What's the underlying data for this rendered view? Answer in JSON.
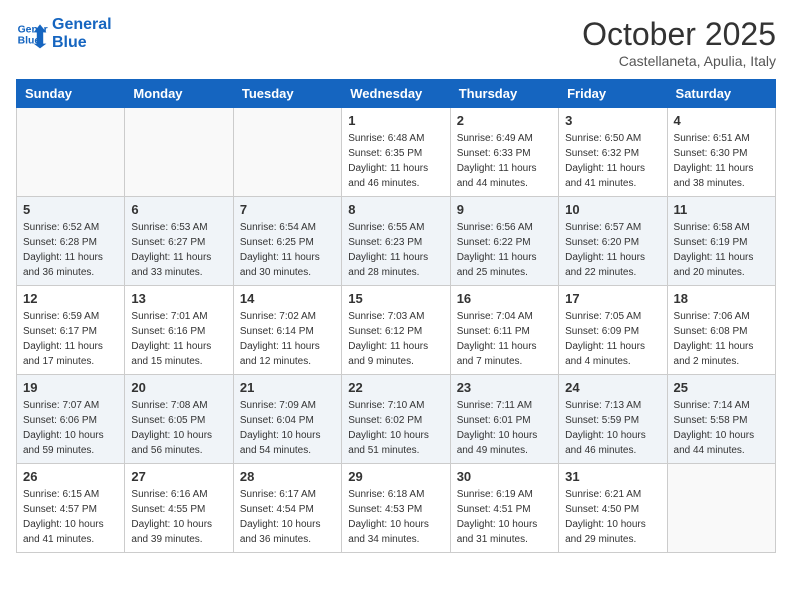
{
  "header": {
    "logo_line1": "General",
    "logo_line2": "Blue",
    "month": "October 2025",
    "location": "Castellaneta, Apulia, Italy"
  },
  "weekdays": [
    "Sunday",
    "Monday",
    "Tuesday",
    "Wednesday",
    "Thursday",
    "Friday",
    "Saturday"
  ],
  "weeks": [
    [
      {
        "day": "",
        "info": ""
      },
      {
        "day": "",
        "info": ""
      },
      {
        "day": "",
        "info": ""
      },
      {
        "day": "1",
        "info": "Sunrise: 6:48 AM\nSunset: 6:35 PM\nDaylight: 11 hours\nand 46 minutes."
      },
      {
        "day": "2",
        "info": "Sunrise: 6:49 AM\nSunset: 6:33 PM\nDaylight: 11 hours\nand 44 minutes."
      },
      {
        "day": "3",
        "info": "Sunrise: 6:50 AM\nSunset: 6:32 PM\nDaylight: 11 hours\nand 41 minutes."
      },
      {
        "day": "4",
        "info": "Sunrise: 6:51 AM\nSunset: 6:30 PM\nDaylight: 11 hours\nand 38 minutes."
      }
    ],
    [
      {
        "day": "5",
        "info": "Sunrise: 6:52 AM\nSunset: 6:28 PM\nDaylight: 11 hours\nand 36 minutes."
      },
      {
        "day": "6",
        "info": "Sunrise: 6:53 AM\nSunset: 6:27 PM\nDaylight: 11 hours\nand 33 minutes."
      },
      {
        "day": "7",
        "info": "Sunrise: 6:54 AM\nSunset: 6:25 PM\nDaylight: 11 hours\nand 30 minutes."
      },
      {
        "day": "8",
        "info": "Sunrise: 6:55 AM\nSunset: 6:23 PM\nDaylight: 11 hours\nand 28 minutes."
      },
      {
        "day": "9",
        "info": "Sunrise: 6:56 AM\nSunset: 6:22 PM\nDaylight: 11 hours\nand 25 minutes."
      },
      {
        "day": "10",
        "info": "Sunrise: 6:57 AM\nSunset: 6:20 PM\nDaylight: 11 hours\nand 22 minutes."
      },
      {
        "day": "11",
        "info": "Sunrise: 6:58 AM\nSunset: 6:19 PM\nDaylight: 11 hours\nand 20 minutes."
      }
    ],
    [
      {
        "day": "12",
        "info": "Sunrise: 6:59 AM\nSunset: 6:17 PM\nDaylight: 11 hours\nand 17 minutes."
      },
      {
        "day": "13",
        "info": "Sunrise: 7:01 AM\nSunset: 6:16 PM\nDaylight: 11 hours\nand 15 minutes."
      },
      {
        "day": "14",
        "info": "Sunrise: 7:02 AM\nSunset: 6:14 PM\nDaylight: 11 hours\nand 12 minutes."
      },
      {
        "day": "15",
        "info": "Sunrise: 7:03 AM\nSunset: 6:12 PM\nDaylight: 11 hours\nand 9 minutes."
      },
      {
        "day": "16",
        "info": "Sunrise: 7:04 AM\nSunset: 6:11 PM\nDaylight: 11 hours\nand 7 minutes."
      },
      {
        "day": "17",
        "info": "Sunrise: 7:05 AM\nSunset: 6:09 PM\nDaylight: 11 hours\nand 4 minutes."
      },
      {
        "day": "18",
        "info": "Sunrise: 7:06 AM\nSunset: 6:08 PM\nDaylight: 11 hours\nand 2 minutes."
      }
    ],
    [
      {
        "day": "19",
        "info": "Sunrise: 7:07 AM\nSunset: 6:06 PM\nDaylight: 10 hours\nand 59 minutes."
      },
      {
        "day": "20",
        "info": "Sunrise: 7:08 AM\nSunset: 6:05 PM\nDaylight: 10 hours\nand 56 minutes."
      },
      {
        "day": "21",
        "info": "Sunrise: 7:09 AM\nSunset: 6:04 PM\nDaylight: 10 hours\nand 54 minutes."
      },
      {
        "day": "22",
        "info": "Sunrise: 7:10 AM\nSunset: 6:02 PM\nDaylight: 10 hours\nand 51 minutes."
      },
      {
        "day": "23",
        "info": "Sunrise: 7:11 AM\nSunset: 6:01 PM\nDaylight: 10 hours\nand 49 minutes."
      },
      {
        "day": "24",
        "info": "Sunrise: 7:13 AM\nSunset: 5:59 PM\nDaylight: 10 hours\nand 46 minutes."
      },
      {
        "day": "25",
        "info": "Sunrise: 7:14 AM\nSunset: 5:58 PM\nDaylight: 10 hours\nand 44 minutes."
      }
    ],
    [
      {
        "day": "26",
        "info": "Sunrise: 6:15 AM\nSunset: 4:57 PM\nDaylight: 10 hours\nand 41 minutes."
      },
      {
        "day": "27",
        "info": "Sunrise: 6:16 AM\nSunset: 4:55 PM\nDaylight: 10 hours\nand 39 minutes."
      },
      {
        "day": "28",
        "info": "Sunrise: 6:17 AM\nSunset: 4:54 PM\nDaylight: 10 hours\nand 36 minutes."
      },
      {
        "day": "29",
        "info": "Sunrise: 6:18 AM\nSunset: 4:53 PM\nDaylight: 10 hours\nand 34 minutes."
      },
      {
        "day": "30",
        "info": "Sunrise: 6:19 AM\nSunset: 4:51 PM\nDaylight: 10 hours\nand 31 minutes."
      },
      {
        "day": "31",
        "info": "Sunrise: 6:21 AM\nSunset: 4:50 PM\nDaylight: 10 hours\nand 29 minutes."
      },
      {
        "day": "",
        "info": ""
      }
    ]
  ]
}
